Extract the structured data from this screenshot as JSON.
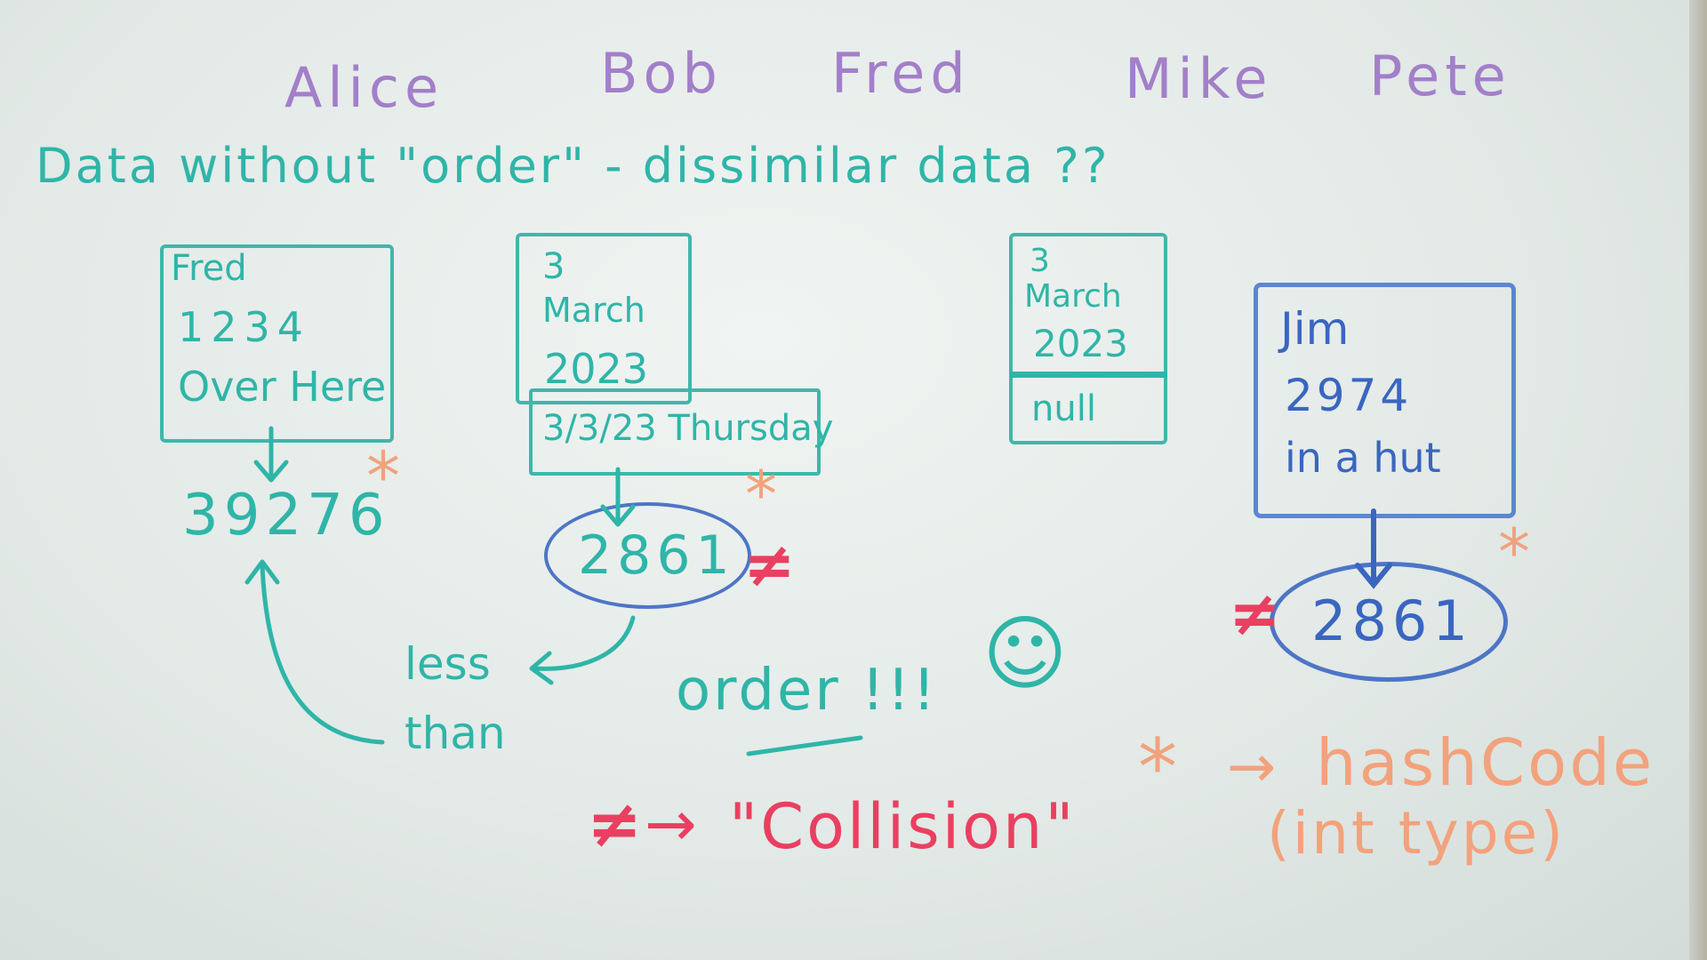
{
  "names": [
    "Alice",
    "Bob",
    "Fred",
    "Mike",
    "Pete"
  ],
  "heading": "Data without \"order\" - dissimilar data ??",
  "box_fred": {
    "lines": [
      "Fred",
      "1234",
      "Over Here"
    ],
    "value": "39276"
  },
  "box_date": {
    "lines": [
      "3",
      "March",
      "2023"
    ],
    "format": "3/3/23 Thursday",
    "value": "2861"
  },
  "box_null": {
    "lines": [
      "3",
      "March",
      "2023"
    ],
    "bottom": "null"
  },
  "box_jim": {
    "lines": [
      "Jim",
      "2974",
      "in a hut"
    ],
    "value": "2861"
  },
  "less_than": [
    "less",
    "than"
  ],
  "order": "order !!!",
  "smiley": "☺",
  "collision": {
    "symbol": "≠",
    "arrow": "→",
    "text": "\"Collision\""
  },
  "hashcode": {
    "symbol": "*",
    "arrow": "→",
    "text": "hashCode",
    "sub": "(int type)"
  },
  "marks": {
    "star": "*",
    "neq": "≠"
  },
  "colors": {
    "teal": "#2fb5a8",
    "blue": "#3a66c0",
    "red": "#ea3f61",
    "orange": "#f2a27c",
    "purple": "#a37fc9"
  }
}
